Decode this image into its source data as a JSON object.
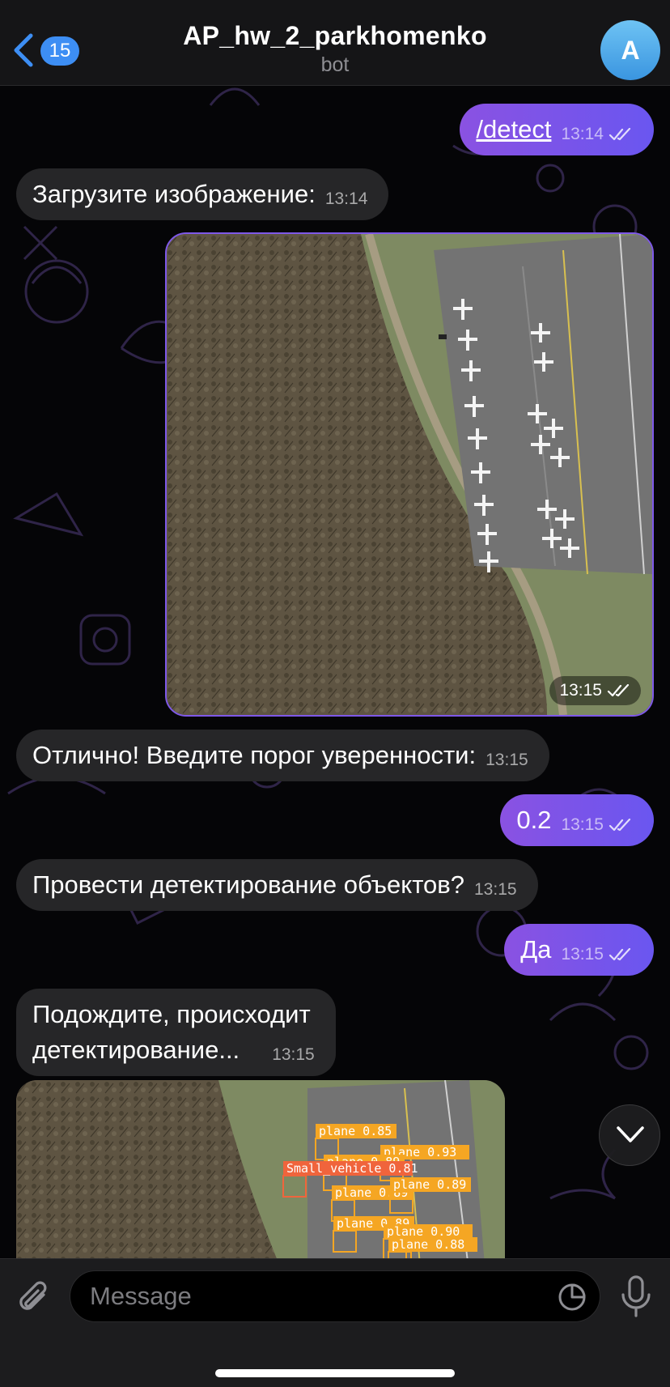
{
  "header": {
    "back_label": "15",
    "title": "AP_hw_2_parkhomenko",
    "subtitle": "bot",
    "avatar_letter": "A"
  },
  "messages": [
    {
      "direction": "out",
      "text": "/detect",
      "time": "13:14",
      "read": true
    },
    {
      "direction": "in",
      "text": "Загрузите изображение:",
      "time": "13:14"
    },
    {
      "direction": "out",
      "type": "photo",
      "time": "13:15",
      "read": true
    },
    {
      "direction": "in",
      "text": "Отлично! Введите порог уверенности:",
      "time": "13:15"
    },
    {
      "direction": "out",
      "text": "0.2",
      "time": "13:15",
      "read": true
    },
    {
      "direction": "in",
      "text": "Провести детектирование объектов?",
      "time": "13:15"
    },
    {
      "direction": "out",
      "text": "Да",
      "time": "13:15",
      "read": true
    },
    {
      "direction": "in",
      "text_line1": "Подождите, происходит",
      "text_line2": "детектирование...",
      "time": "13:15"
    },
    {
      "direction": "in",
      "type": "photo",
      "detections": [
        {
          "label": "plane 0.85"
        },
        {
          "label": "plane 0.93"
        },
        {
          "label": "plane 0.89"
        },
        {
          "label": "Small_vehicle 0.81"
        },
        {
          "label": "plane 0.89"
        },
        {
          "label": "plane 0.89"
        },
        {
          "label": "plane 0.89"
        },
        {
          "label": "plane 0.90"
        },
        {
          "label": "plane 0.88"
        }
      ]
    }
  ],
  "composer": {
    "placeholder": "Message"
  },
  "colors": {
    "outgoing_bubble": "#7b55ea",
    "incoming_bubble": "#262628",
    "accent": "#3d8ef4",
    "detection_box": "#f5a623",
    "vehicle_box": "#f0643c"
  },
  "icons": [
    "back-chevron-icon",
    "paperclip-icon",
    "sticker-icon",
    "microphone-icon",
    "chevron-down-icon",
    "double-check-icon"
  ]
}
